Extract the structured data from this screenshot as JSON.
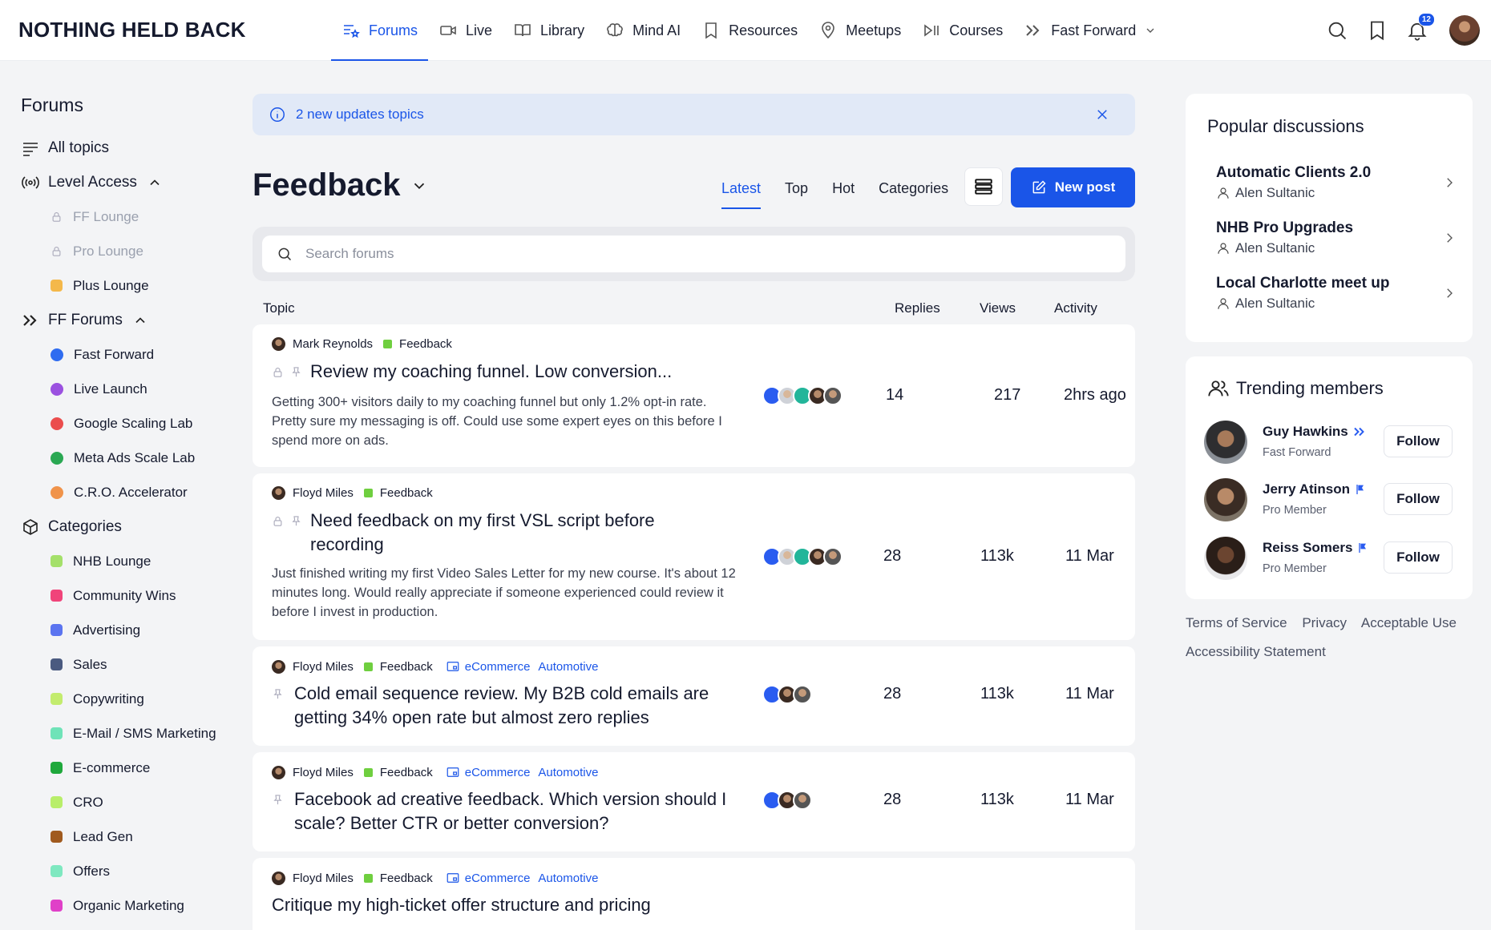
{
  "brand": "NOTHING HELD BACK",
  "nav": [
    {
      "label": "Forums",
      "icon": "forums-icon",
      "active": true
    },
    {
      "label": "Live",
      "icon": "video-icon"
    },
    {
      "label": "Library",
      "icon": "book-icon"
    },
    {
      "label": "Mind AI",
      "icon": "brain-icon"
    },
    {
      "label": "Resources",
      "icon": "bookmark-icon"
    },
    {
      "label": "Meetups",
      "icon": "location-pin-icon"
    },
    {
      "label": "Courses",
      "icon": "play-pause-icon"
    },
    {
      "label": "Fast Forward",
      "icon": "fast-forward-icon"
    }
  ],
  "notifications_count": "12",
  "sidebar": {
    "title": "Forums",
    "all_topics": "All topics",
    "level_access": {
      "label": "Level Access",
      "items": [
        {
          "label": "FF Lounge",
          "locked": true
        },
        {
          "label": "Pro Lounge",
          "locked": true
        },
        {
          "label": "Plus Lounge",
          "color": "#f4b84a"
        }
      ]
    },
    "ff_forums": {
      "label": "FF Forums",
      "items": [
        {
          "label": "Fast Forward",
          "color": "#2f6cf0"
        },
        {
          "label": "Live Launch",
          "color": "#9b51e0"
        },
        {
          "label": "Google Scaling Lab",
          "color": "#eb4d4d"
        },
        {
          "label": "Meta Ads Scale Lab",
          "color": "#2aa853"
        },
        {
          "label": "C.R.O. Accelerator",
          "color": "#f0934a"
        }
      ]
    },
    "categories": {
      "label": "Categories",
      "items": [
        {
          "label": "NHB Lounge",
          "color": "#a4e06a"
        },
        {
          "label": "Community Wins",
          "color": "#f0447a"
        },
        {
          "label": "Advertising",
          "color": "#5b74f0"
        },
        {
          "label": "Sales",
          "color": "#4a5a80"
        },
        {
          "label": "Copywriting",
          "color": "#c3ec6e"
        },
        {
          "label": "E-Mail / SMS Marketing",
          "color": "#6fe3b8"
        },
        {
          "label": "E-commerce",
          "color": "#1fa83c"
        },
        {
          "label": "CRO",
          "color": "#b8ee6a"
        },
        {
          "label": "Lead Gen",
          "color": "#a05a1e"
        },
        {
          "label": "Offers",
          "color": "#7ee8c0"
        },
        {
          "label": "Organic Marketing",
          "color": "#e040c8"
        }
      ]
    }
  },
  "banner": "2 new updates topics",
  "page_title": "Feedback",
  "tabs": [
    "Latest",
    "Top",
    "Hot",
    "Categories"
  ],
  "new_post": "New post",
  "search_placeholder": "Search forums",
  "table_headers": {
    "topic": "Topic",
    "replies": "Replies",
    "views": "Views",
    "activity": "Activity"
  },
  "posts": [
    {
      "author": "Mark Reynolds",
      "category": "Feedback",
      "title": "Review my coaching funnel. Low conversion...",
      "excerpt": "Getting 300+ visitors daily to my coaching funnel but only 1.2% opt-in rate. Pretty sure my messaging is off. Could use some expert eyes on this before I spend more on ads.",
      "replies": "14",
      "views": "217",
      "activity": "2hrs ago"
    },
    {
      "author": "Floyd Miles",
      "category": "Feedback",
      "title": "Need feedback on my first VSL script before recording",
      "excerpt": "Just finished writing my first Video Sales Letter for my new course. It's about 12 minutes long. Would really appreciate if someone experienced could review it before I invest in production.",
      "replies": "28",
      "views": "113k",
      "activity": "11 Mar"
    },
    {
      "author": "Floyd Miles",
      "category": "Feedback",
      "tags": [
        "eCommerce",
        "Automotive"
      ],
      "title": "Cold email sequence review. My B2B cold emails are getting 34% open rate but almost zero replies",
      "replies": "28",
      "views": "113k",
      "activity": "11 Mar"
    },
    {
      "author": "Floyd Miles",
      "category": "Feedback",
      "tags": [
        "eCommerce",
        "Automotive"
      ],
      "title": "Facebook ad creative feedback. Which version should I scale? Better CTR or better conversion?",
      "replies": "28",
      "views": "113k",
      "activity": "11 Mar"
    },
    {
      "author": "Floyd Miles",
      "category": "Feedback",
      "tags": [
        "eCommerce",
        "Automotive"
      ],
      "title": "Critique my high-ticket offer structure and pricing"
    }
  ],
  "popular": {
    "title": "Popular discussions",
    "items": [
      {
        "title": "Automatic Clients 2.0",
        "author": "Alen Sultanic"
      },
      {
        "title": "NHB Pro Upgrades",
        "author": "Alen Sultanic"
      },
      {
        "title": "Local Charlotte meet up",
        "author": "Alen Sultanic"
      }
    ]
  },
  "trending": {
    "title": "Trending members",
    "follow_label": "Follow",
    "members": [
      {
        "name": "Guy Hawkins",
        "role": "Fast Forward",
        "badge": "fast-forward-icon"
      },
      {
        "name": "Jerry Atinson",
        "role": "Pro Member",
        "badge": "flag-icon"
      },
      {
        "name": "Reiss Somers",
        "role": "Pro Member",
        "badge": "flag-icon"
      }
    ]
  },
  "footer_links": [
    "Terms of Service",
    "Privacy",
    "Acceptable Use",
    "Accessibility Statement"
  ],
  "colors": {
    "accent": "#1a55e8",
    "banner_bg": "#e1e9f7",
    "feedback_tag": "#6fcf3f"
  }
}
